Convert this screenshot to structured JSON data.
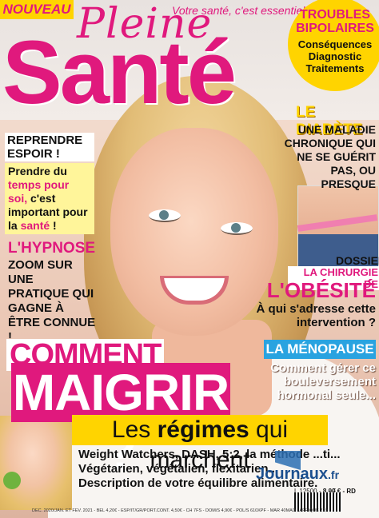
{
  "masthead": {
    "badge": "NOUVEAU",
    "pleine": "Pleine",
    "slogan": "Votre santé, c'est essentiel !",
    "sante": "Santé"
  },
  "circle": {
    "title": "TROUBLES BIPOLAIRES",
    "body": "Conséquences Diagnostic Traitements"
  },
  "left_box": {
    "tag": "REPRENDRE ESPOIR !",
    "body_a": "Prendre du ",
    "body_b": "temps pour soi,",
    "body_c": " c'est important pour la ",
    "body_d": "santé",
    "body_e": " !"
  },
  "hypnose": {
    "title": "L'HYPNOSE",
    "body": "ZOOM SUR UNE PRATIQUE QUI GAGNE À ÊTRE CONNUE !"
  },
  "diabete": {
    "title": "LE DIABÈTE",
    "body": "UNE MALADIE CHRONIQUE QUI NE SE GUÉRIT PAS, OU PRESQUE"
  },
  "obesite": {
    "dossier": "DOSSIER",
    "chirurgie": "LA CHIRURGIE DE",
    "title": "L'OBÉSITÉ",
    "body": "À qui s'adresse cette intervention ?"
  },
  "menopause": {
    "title": "LA MÉNOPAUSE",
    "body": "Comment gérer ce bouleversement hormonal seule..."
  },
  "main": {
    "comment": "COMMENT",
    "maigrir": "MAIGRIR ?",
    "les": "Les ",
    "regimes": "régimes",
    "marchent": " qui marchent",
    "list": [
      "Weight Watchers, DASH, 5:2, la méthode ...ti...",
      "Végétarien, végétalien, flexitarien...",
      "Description de votre équilibre alimentaire."
    ]
  },
  "footer": {
    "code": "L 12500 - 8 - F",
    "price": "3,90 € - RD",
    "fine": "DÉC. 2020/JAN. ET FÉV. 2021 - BEL 4,20€ - ESP/IT/GR/PORT.CONT. 4,50€ - CH 7FS - DOM/S 4,90€ - POL/S 610XPF - MAR 40MAD - AFRIQUE 2790XAF",
    "logo": "Journaux",
    "logo_tld": ".fr"
  }
}
